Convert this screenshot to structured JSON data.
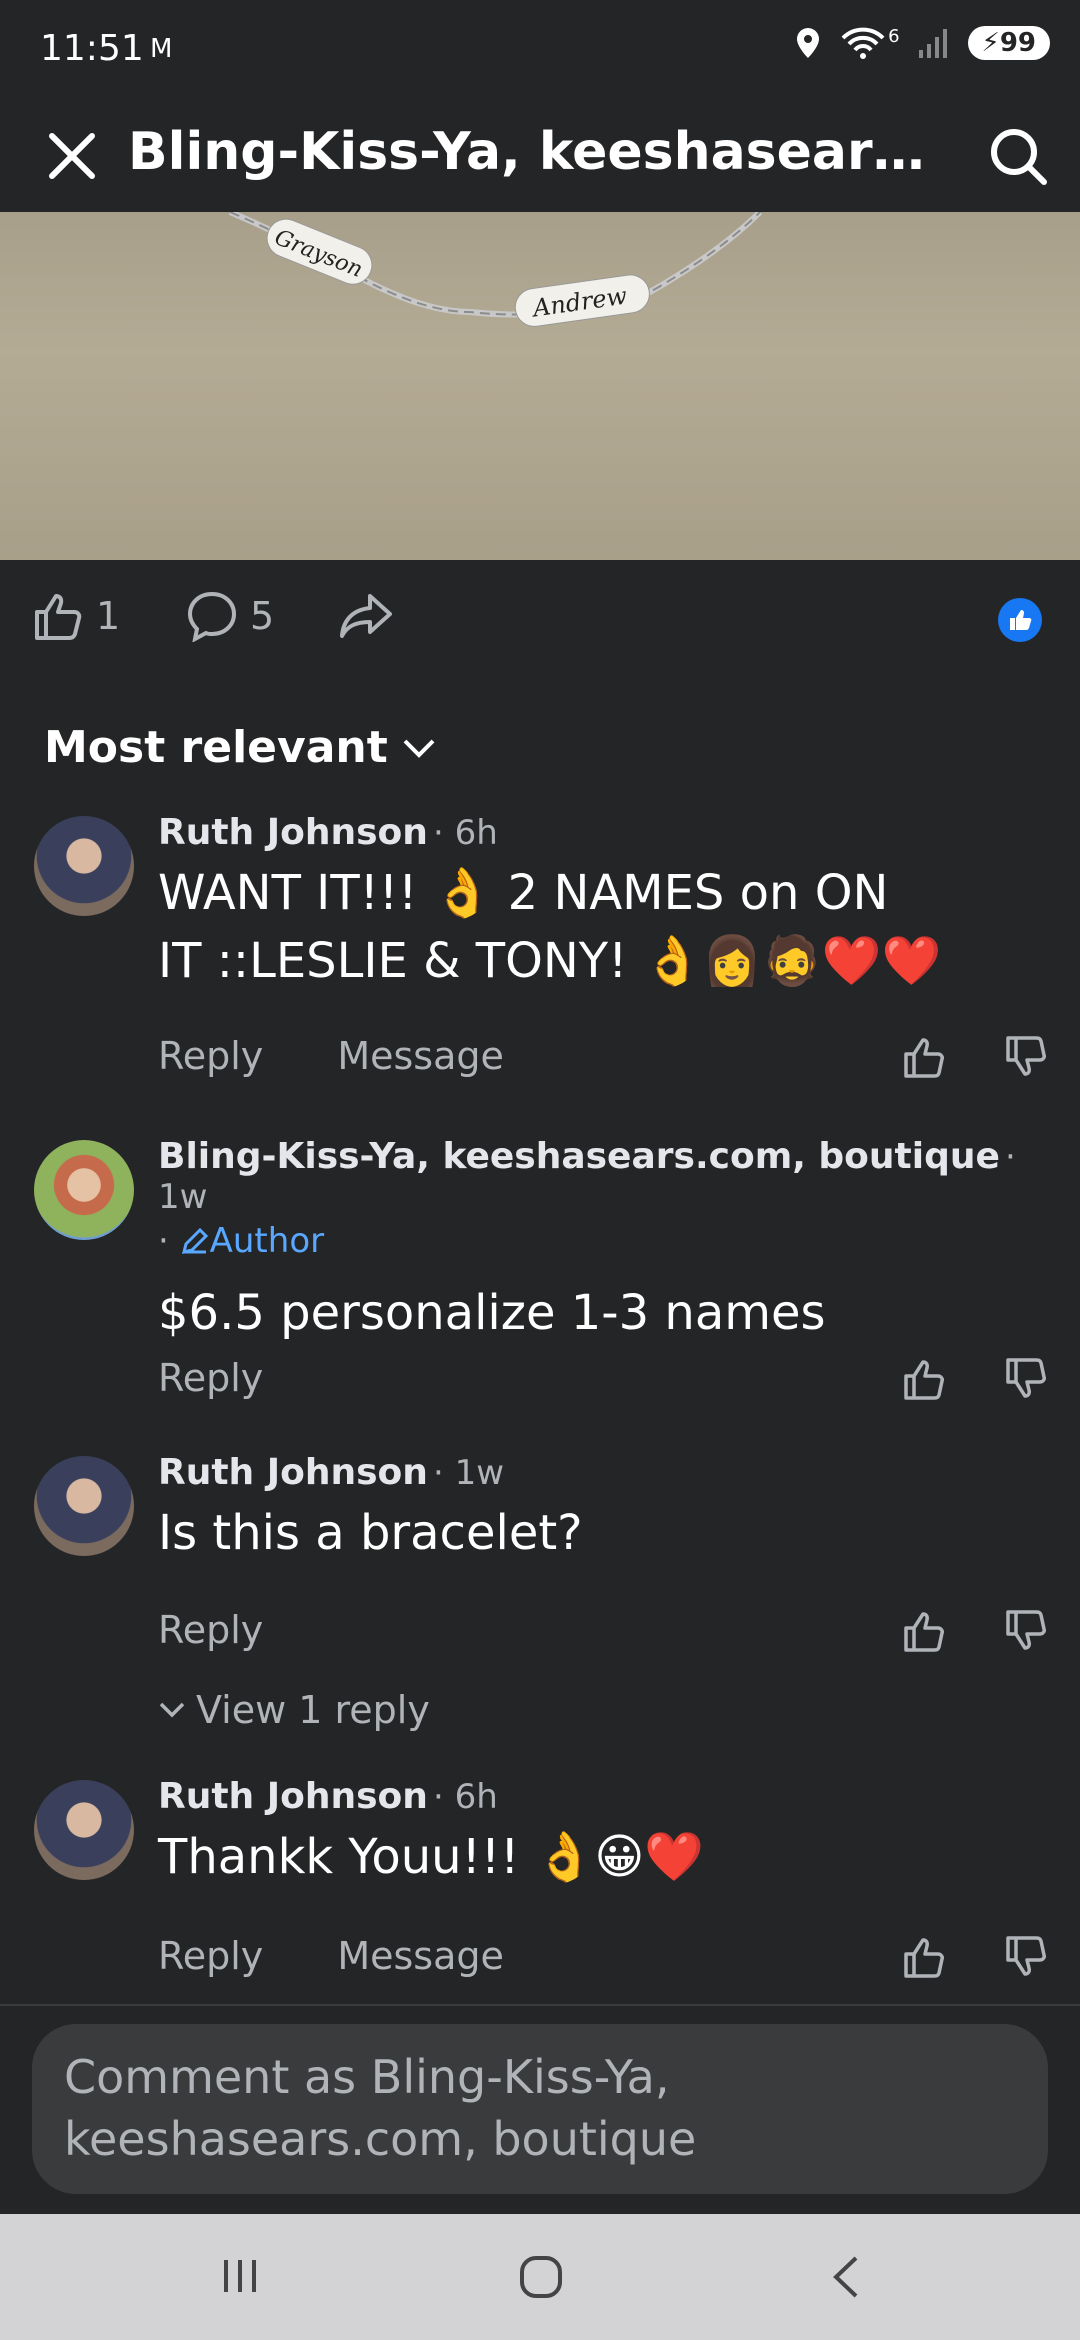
{
  "status": {
    "time": "11:51",
    "carrier_icon": "M",
    "network": "6",
    "battery": "99"
  },
  "header": {
    "title": "Bling-Kiss-Ya, keeshasears.com,..."
  },
  "photo": {
    "tag1": "Grayson",
    "tag2": "Andrew"
  },
  "post_actions": {
    "like_count": "1",
    "comment_count": "5"
  },
  "sort": {
    "label": "Most relevant"
  },
  "comments": [
    {
      "name": "Ruth Johnson",
      "time": "6h",
      "text_line1": "WANT IT!!! 👌 2 NAMES on ON",
      "text_line2": "IT ::LESLIE & TONY! 👌👩🧔❤️❤️",
      "reply": "Reply",
      "message": "Message"
    },
    {
      "name": "Bling-Kiss-Ya, keeshasears.com, boutique",
      "time": "1w",
      "badge": "Author",
      "text": "$6.5 personalize 1-3 names",
      "reply": "Reply"
    },
    {
      "name": "Ruth Johnson",
      "time": "1w",
      "text": "Is this a bracelet?",
      "reply": "Reply",
      "view_replies": "View 1 reply"
    },
    {
      "name": "Ruth Johnson",
      "time": "6h",
      "text": "Thankk Youu!!! 👌😀❤️",
      "reply": "Reply",
      "message": "Message"
    }
  ],
  "composer": {
    "placeholder_line1": "Comment as Bling-Kiss-Ya,",
    "placeholder_line2": "keeshasears.com, boutique"
  },
  "icons": {
    "close": "close-icon",
    "search": "search-icon",
    "like": "thumbs-up-icon",
    "comment": "comment-icon",
    "share": "share-icon",
    "dislike": "thumbs-down-icon"
  }
}
